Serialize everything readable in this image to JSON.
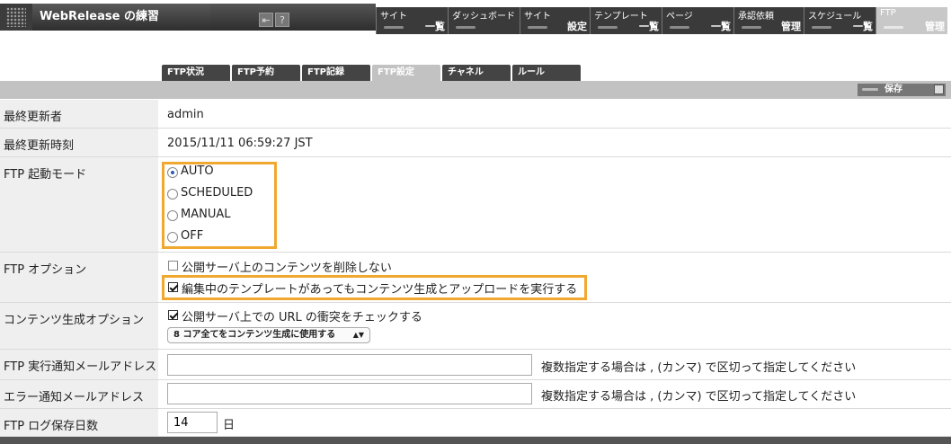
{
  "header": {
    "title": "WebRelease の練習",
    "icon_back": "⇤",
    "icon_help": "?"
  },
  "nav": [
    {
      "top": "サイト",
      "bottom": "一覧",
      "width": 80
    },
    {
      "top": "ダッシュボード",
      "bottom": "",
      "width": 80
    },
    {
      "top": "サイト",
      "bottom": "設定",
      "width": 78
    },
    {
      "top": "テンプレート",
      "bottom": "一覧",
      "width": 80
    },
    {
      "top": "ページ",
      "bottom": "一覧",
      "width": 80
    },
    {
      "top": "承認依頼",
      "bottom": "管理",
      "width": 78
    },
    {
      "top": "スケジュール",
      "bottom": "一覧",
      "width": 80
    },
    {
      "top": "FTP",
      "bottom": "管理",
      "width": 80
    }
  ],
  "tabs": [
    "FTP状況",
    "FTP予約",
    "FTP記録",
    "FTP設定",
    "チャネル",
    "ルール"
  ],
  "toolbar": {
    "save_label": "保存"
  },
  "form": {
    "last_updater": {
      "label": "最終更新者",
      "value": "admin"
    },
    "last_updated": {
      "label": "最終更新時刻",
      "value": "2015/11/11 06:59:27 JST"
    },
    "ftp_mode": {
      "label": "FTP 起動モード",
      "options": [
        "AUTO",
        "SCHEDULED",
        "MANUAL",
        "OFF"
      ],
      "selected": "AUTO"
    },
    "ftp_options": {
      "label": "FTP オプション",
      "opt1": "公開サーバ上のコンテンツを削除しない",
      "opt1_checked": false,
      "opt2": "編集中のテンプレートがあってもコンテンツ生成とアップロードを実行する",
      "opt2_checked": true
    },
    "gen_options": {
      "label": "コンテンツ生成オプション",
      "opt1": "公開サーバ上での URL の衝突をチェックする",
      "opt1_checked": true,
      "select_value": "8 コア全てをコンテンツ生成に使用する"
    },
    "notify_email": {
      "label": "FTP 実行通知メールアドレス",
      "value": "",
      "hint": "複数指定する場合は , (カンマ) で区切って指定してください"
    },
    "error_email": {
      "label": "エラー通知メールアドレス",
      "value": "",
      "hint": "複数指定する場合は , (カンマ) で区切って指定してください"
    },
    "log_days": {
      "label": "FTP ログ保存日数",
      "value": "14",
      "unit": "日"
    }
  }
}
